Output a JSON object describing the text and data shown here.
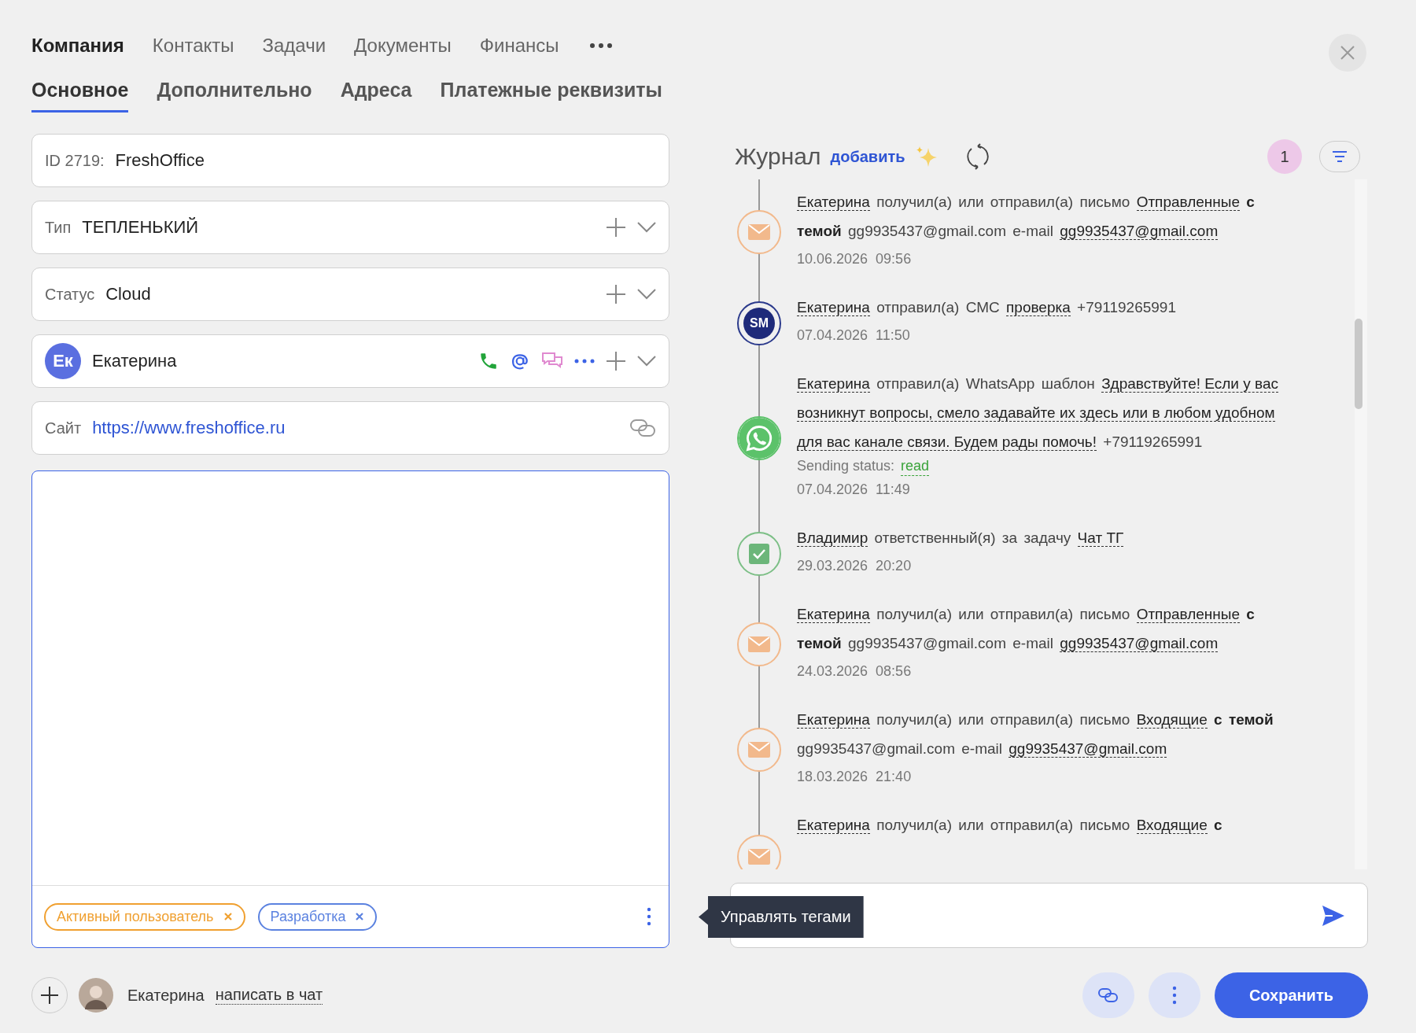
{
  "top_tabs": [
    {
      "label": "Компания",
      "selected": true
    },
    {
      "label": "Контакты",
      "selected": false
    },
    {
      "label": "Задачи",
      "selected": false
    },
    {
      "label": "Документы",
      "selected": false
    },
    {
      "label": "Финансы",
      "selected": false
    }
  ],
  "sub_tabs": [
    {
      "label": "Основное",
      "selected": true
    },
    {
      "label": "Дополнительно",
      "selected": false
    },
    {
      "label": "Адреса",
      "selected": false
    },
    {
      "label": "Платежные реквизиты",
      "selected": false
    }
  ],
  "fields": [
    {
      "kind": "text",
      "label": "ID 2719:",
      "value": "FreshOffice"
    },
    {
      "kind": "select",
      "label": "Тип",
      "value": "ТЕПЛЕНЬКИЙ"
    },
    {
      "kind": "select",
      "label": "Статус",
      "value": "Cloud"
    },
    {
      "kind": "contact",
      "avatar": "Ек",
      "value": "Екатерина"
    },
    {
      "kind": "link",
      "label": "Сайт",
      "value": "https://www.freshoffice.ru"
    }
  ],
  "notes": {
    "tags": [
      {
        "label": "Активный пользователь",
        "color": "#f0a030"
      },
      {
        "label": "Разработка",
        "color": "#5b82e0"
      }
    ],
    "tooltip": "Управлять тегами"
  },
  "journal": {
    "title": "Журнал",
    "add_link": "добавить",
    "badge": "1",
    "entries": [
      {
        "kind": "mail",
        "segments": [
          {
            "kind": "link",
            "text": "Екатерина"
          },
          {
            "kind": "text",
            "text": "получил(а) или отправил(а) письмо"
          },
          {
            "kind": "link",
            "text": "Отправленные"
          },
          {
            "kind": "strong",
            "text": "с"
          },
          {
            "kind": "strong",
            "text": "темой"
          },
          {
            "kind": "text",
            "text": "gg9935437@gmail.com"
          },
          {
            "kind": "text",
            "text": "e-mail"
          },
          {
            "kind": "link",
            "text": "gg9935437@gmail.com"
          }
        ],
        "date": "10.06.2026",
        "time": "09:56"
      },
      {
        "kind": "sms",
        "badge": "SM",
        "segments": [
          {
            "kind": "link",
            "text": "Екатерина"
          },
          {
            "kind": "text",
            "text": "отправил(а) СМС"
          },
          {
            "kind": "link",
            "text": "проверка"
          },
          {
            "kind": "text",
            "text": "+79119265991"
          }
        ],
        "date": "07.04.2026",
        "time": "11:50"
      },
      {
        "kind": "whatsapp",
        "segments": [
          {
            "kind": "link",
            "text": "Екатерина"
          },
          {
            "kind": "text",
            "text": "отправил(а) WhatsApp шаблон"
          },
          {
            "kind": "link",
            "text": "Здравствуйте! Если у вас"
          },
          {
            "kind": "link",
            "text": "возникнут вопросы, смело задавайте их здесь или в любом удобном"
          },
          {
            "kind": "link",
            "text": "для вас канале связи. Будем рады помочь!"
          },
          {
            "kind": "text",
            "text": "+79119265991"
          }
        ],
        "status": {
          "label": "Sending status:",
          "value": "read"
        },
        "date": "07.04.2026",
        "time": "11:49"
      },
      {
        "kind": "task",
        "segments": [
          {
            "kind": "link",
            "text": "Владимир"
          },
          {
            "kind": "text",
            "text": "ответственный(я) за задачу"
          },
          {
            "kind": "link",
            "text": "Чат ТГ"
          }
        ],
        "date": "29.03.2026",
        "time": "20:20"
      },
      {
        "kind": "mail",
        "segments": [
          {
            "kind": "link",
            "text": "Екатерина"
          },
          {
            "kind": "text",
            "text": "получил(а) или отправил(а) письмо"
          },
          {
            "kind": "link",
            "text": "Отправленные"
          },
          {
            "kind": "strong",
            "text": "с"
          },
          {
            "kind": "strong",
            "text": "темой"
          },
          {
            "kind": "text",
            "text": "gg9935437@gmail.com"
          },
          {
            "kind": "text",
            "text": "e-mail"
          },
          {
            "kind": "link",
            "text": "gg9935437@gmail.com"
          }
        ],
        "date": "24.03.2026",
        "time": "08:56"
      },
      {
        "kind": "mail",
        "segments": [
          {
            "kind": "link",
            "text": "Екатерина"
          },
          {
            "kind": "text",
            "text": "получил(а) или отправил(а) письмо"
          },
          {
            "kind": "link",
            "text": "Входящие"
          },
          {
            "kind": "strong",
            "text": "с"
          },
          {
            "kind": "strong",
            "text": "темой"
          },
          {
            "kind": "text",
            "text": "gg9935437@gmail.com"
          },
          {
            "kind": "text",
            "text": "e-mail"
          },
          {
            "kind": "link",
            "text": "gg9935437@gmail.com"
          }
        ],
        "date": "18.03.2026",
        "time": "21:40"
      },
      {
        "kind": "mail",
        "segments": [
          {
            "kind": "link",
            "text": "Екатерина"
          },
          {
            "kind": "text",
            "text": "получил(а) или отправил(а) письмо"
          },
          {
            "kind": "link",
            "text": "Входящие"
          },
          {
            "kind": "strong",
            "text": "с"
          }
        ]
      }
    ]
  },
  "footer": {
    "user": "Екатерина",
    "chat_link": "написать в чат",
    "save_button": "Сохранить"
  }
}
